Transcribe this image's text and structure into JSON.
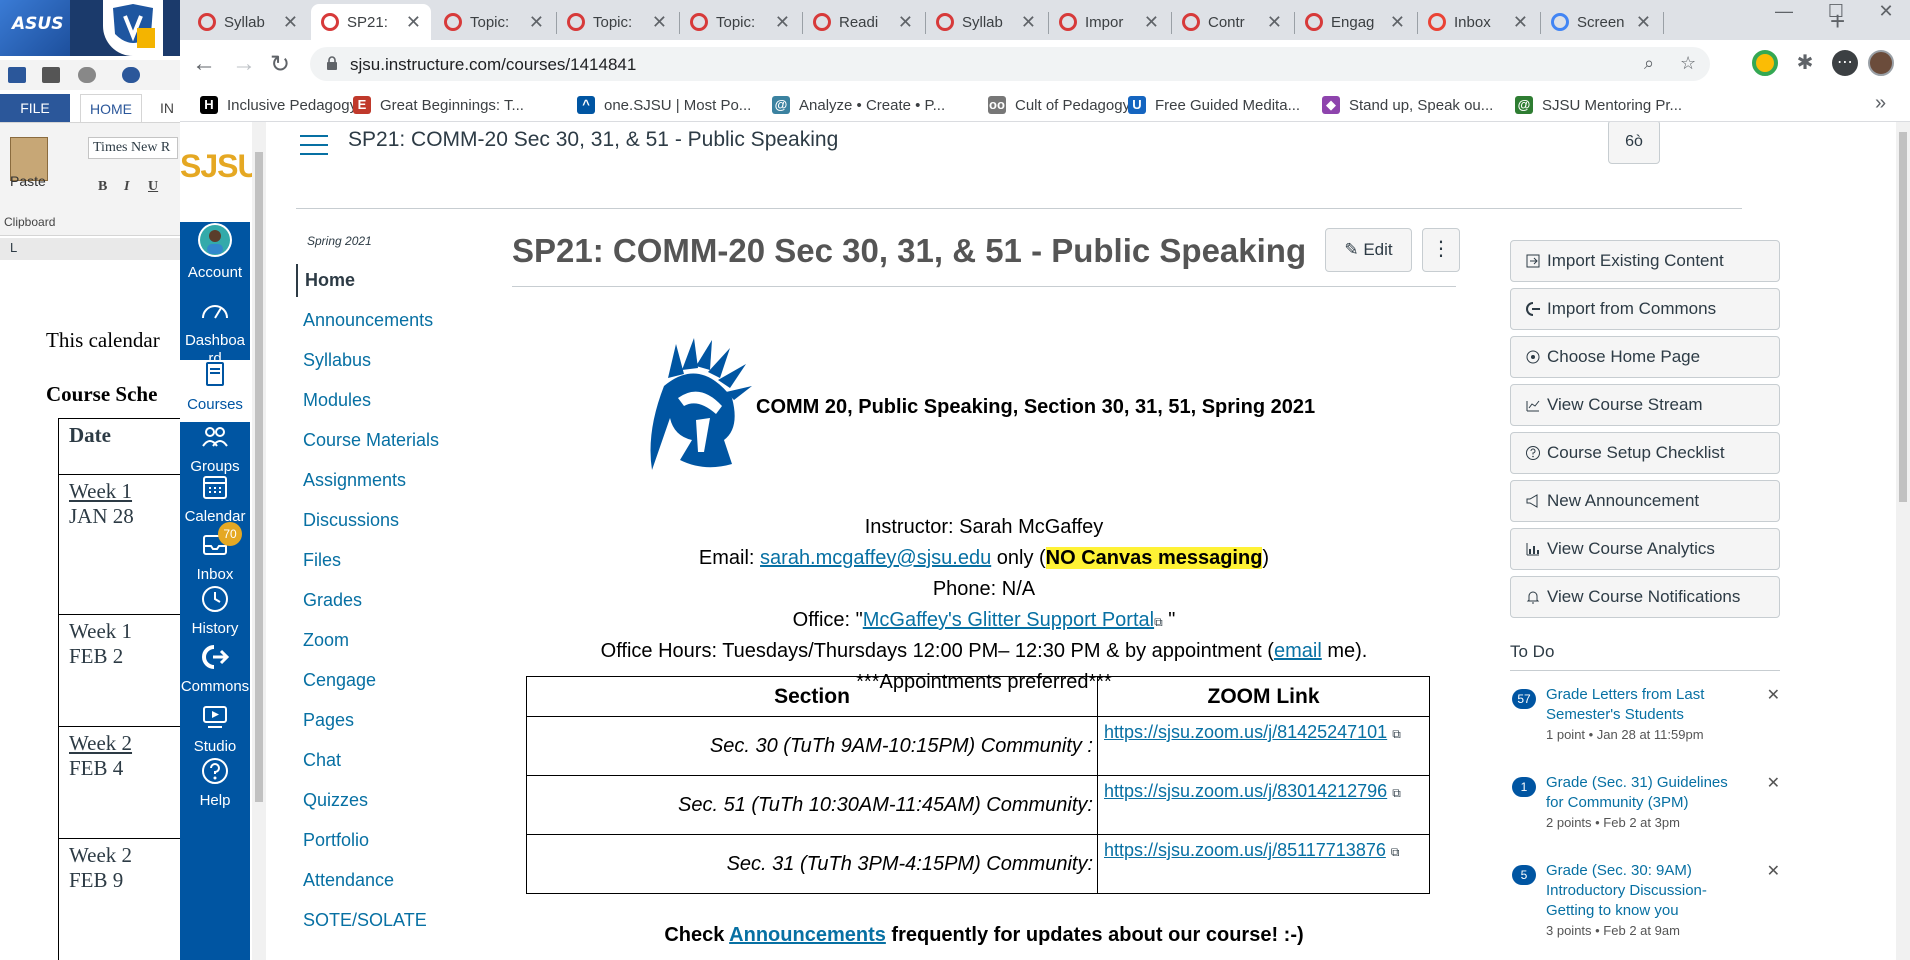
{
  "word": {
    "tab_file": "FILE",
    "tab_home": "HOME",
    "tab_insert": "IN",
    "paste_label": "Paste",
    "font_name": "Times New R",
    "bold": "B",
    "italic": "I",
    "underline": "U",
    "clipboard_label": "Clipboard",
    "tab_marker": "L",
    "doc_line": "This calendar",
    "doc_heading": "Course Sche",
    "table_header": "Date",
    "rows": [
      {
        "week": "Week 1",
        "date": "JAN 28"
      },
      {
        "week": "Week 1",
        "date": "FEB 2"
      },
      {
        "week": "Week 2",
        "date": "FEB 4"
      },
      {
        "week": "Week 2",
        "date": "FEB 9"
      }
    ],
    "asus_text": "ASUS"
  },
  "browser": {
    "tabs": [
      {
        "title": "Syllab",
        "active": false,
        "icon_color": "#d73a3a"
      },
      {
        "title": "SP21:",
        "active": true,
        "icon_color": "#d73a3a"
      },
      {
        "title": "Topic:",
        "active": false,
        "icon_color": "#d73a3a"
      },
      {
        "title": "Topic:",
        "active": false,
        "icon_color": "#d73a3a"
      },
      {
        "title": "Topic:",
        "active": false,
        "icon_color": "#d73a3a"
      },
      {
        "title": "Readi",
        "active": false,
        "icon_color": "#d73a3a"
      },
      {
        "title": "Syllab",
        "active": false,
        "icon_color": "#d73a3a"
      },
      {
        "title": "Impor",
        "active": false,
        "icon_color": "#d73a3a"
      },
      {
        "title": "Contr",
        "active": false,
        "icon_color": "#d73a3a"
      },
      {
        "title": "Engag",
        "active": false,
        "icon_color": "#d73a3a"
      },
      {
        "title": "Inbox",
        "active": false,
        "icon_color": "#ea4335"
      },
      {
        "title": "Screen",
        "active": false,
        "icon_color": "#4285f4"
      }
    ],
    "url": "sjsu.instructure.com/courses/1414841",
    "bookmarks": [
      {
        "label": "Inclusive Pedagogy...",
        "color": "#000000",
        "glyph": "H"
      },
      {
        "label": "Great Beginnings: T...",
        "color": "#c0392b",
        "glyph": "E"
      },
      {
        "label": "one.SJSU | Most Po...",
        "color": "#0055a2",
        "glyph": "^"
      },
      {
        "label": "Analyze • Create • P...",
        "color": "#3b82a0",
        "glyph": "@"
      },
      {
        "label": "Cult of Pedagogy",
        "color": "#777777",
        "glyph": "oo"
      },
      {
        "label": "Free Guided Medita...",
        "color": "#1565c0",
        "glyph": "U"
      },
      {
        "label": "Stand up, Speak ou...",
        "color": "#8e44ad",
        "glyph": "◆"
      },
      {
        "label": "SJSU Mentoring Pr...",
        "color": "#2e7d32",
        "glyph": "@"
      }
    ]
  },
  "canvas": {
    "logo": "SJSU",
    "global_nav": [
      {
        "label": "Account",
        "icon": "avatar"
      },
      {
        "label": "Dashboard",
        "icon": "dashboard-icon"
      },
      {
        "label": "Courses",
        "icon": "book-icon"
      },
      {
        "label": "Groups",
        "icon": "groups-icon"
      },
      {
        "label": "Calendar",
        "icon": "calendar-icon"
      },
      {
        "label": "Inbox",
        "icon": "inbox-icon",
        "badge": "70"
      },
      {
        "label": "History",
        "icon": "clock-icon"
      },
      {
        "label": "Commons",
        "icon": "commons-icon"
      },
      {
        "label": "Studio",
        "icon": "studio-icon"
      },
      {
        "label": "Help",
        "icon": "help-icon"
      }
    ],
    "breadcrumb": "SP21: COMM-20 Sec 30, 31, & 51 - Public Speaking",
    "reader_icon": "6ò",
    "term": "Spring 2021",
    "course_nav": [
      "Home",
      "Announcements",
      "Syllabus",
      "Modules",
      "Course Materials",
      "Assignments",
      "Discussions",
      "Files",
      "Grades",
      "Zoom",
      "Cengage",
      "Pages",
      "Chat",
      "Quizzes",
      "Portfolio",
      "Attendance",
      "SOTE/SOLATE"
    ],
    "page_title": "SP21: COMM-20 Sec 30, 31, & 51 - Public Speaking",
    "edit_label": "Edit",
    "more_label": "⋮",
    "course_heading": "COMM 20, Public Speaking, Section 30, 31, 51, Spring 2021",
    "instructor": "Instructor: Sarah McGaffey",
    "email_prefix": "Email: ",
    "email": "sarah.mcgaffey@sjsu.edu",
    "email_mid": " only (",
    "no_canvas": "NO Canvas messaging",
    "email_suffix": ")",
    "phone": "Phone: N/A",
    "office_prefix": "Office: \"",
    "office_link": "McGaffey's Glitter Support Portal",
    "office_suffix": " \"",
    "hours_prefix": "Office Hours: Tuesdays/Thursdays 12:00 PM– 12:30 PM & by appointment (",
    "hours_link": "email",
    "hours_suffix": " me).",
    "appointments": "***Appointments preferred***",
    "table_headers": [
      "Section",
      "ZOOM Link"
    ],
    "sections": [
      {
        "name": "Sec. 30 (TuTh 9AM-10:15PM) Community :",
        "link": "https://sjsu.zoom.us/j/81425247101"
      },
      {
        "name": "Sec. 51 (TuTh 10:30AM-11:45AM) Community:",
        "link": "https://sjsu.zoom.us/j/83014212796"
      },
      {
        "name": "Sec. 31 (TuTh 3PM-4:15PM) Community:",
        "link": "https://sjsu.zoom.us/j/85117713876"
      }
    ],
    "check_prefix": "Check ",
    "check_link": "Announcements",
    "check_suffix": " frequently for updates about our course! :-)",
    "actions": [
      {
        "label": "Import Existing Content",
        "icon": "import-icon"
      },
      {
        "label": "Import from Commons",
        "icon": "commons-icon"
      },
      {
        "label": "Choose Home Page",
        "icon": "target-icon"
      },
      {
        "label": "View Course Stream",
        "icon": "stream-icon"
      },
      {
        "label": "Course Setup Checklist",
        "icon": "question-icon"
      },
      {
        "label": "New Announcement",
        "icon": "megaphone-icon"
      },
      {
        "label": "View Course Analytics",
        "icon": "analytics-icon"
      },
      {
        "label": "View Course Notifications",
        "icon": "bell-icon"
      }
    ],
    "todo_heading": "To Do",
    "todos": [
      {
        "count": "57",
        "title": "Grade Letters from Last Semester's Students",
        "meta": "1 point • Jan 28 at 11:59pm"
      },
      {
        "count": "1",
        "title": "Grade (Sec. 31) Guidelines for Community (3PM)",
        "meta": "2 points • Feb 2 at 3pm"
      },
      {
        "count": "5",
        "title": "Grade (Sec. 30: 9AM) Introductory Discussion- Getting to know you",
        "meta": "3 points • Feb 2 at 9am"
      }
    ],
    "colors": {
      "nav_blue": "#0055a2",
      "gold": "#e5a823",
      "link": "#0770a3",
      "highlight": "#fff235"
    }
  }
}
